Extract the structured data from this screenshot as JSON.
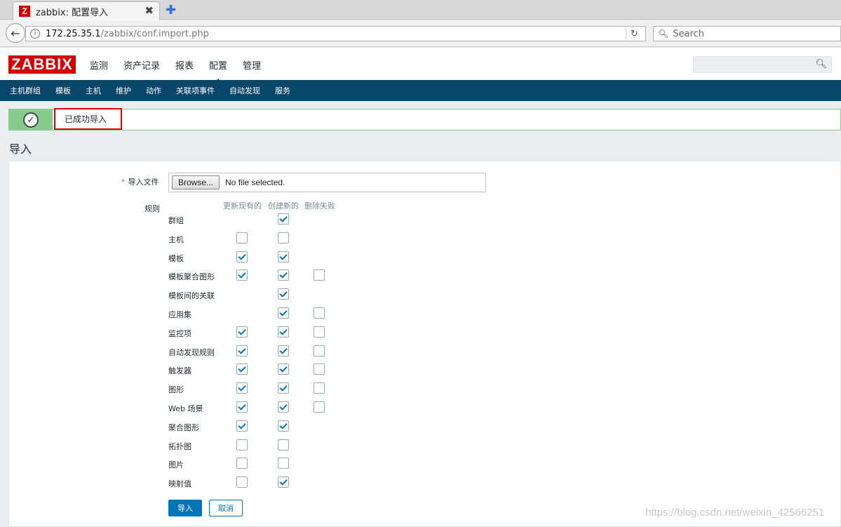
{
  "browser": {
    "tab_icon_letter": "Z",
    "tab_title": "zabbix: 配置导入",
    "tab_close": "✖",
    "new_tab": "✚",
    "url_host": "172.25.35.1",
    "url_path": "/zabbix/conf.import.php",
    "search_placeholder": "Search"
  },
  "header": {
    "logo": "ZABBIX",
    "menu": [
      {
        "label": "监测"
      },
      {
        "label": "资产记录"
      },
      {
        "label": "报表"
      },
      {
        "label": "配置",
        "active": true
      },
      {
        "label": "管理"
      }
    ]
  },
  "submenu": [
    {
      "label": "主机群组"
    },
    {
      "label": "模板"
    },
    {
      "label": "主机"
    },
    {
      "label": "维护"
    },
    {
      "label": "动作"
    },
    {
      "label": "关联项事件"
    },
    {
      "label": "自动发现"
    },
    {
      "label": "服务"
    }
  ],
  "message": {
    "text": "已成功导入"
  },
  "page": {
    "title": "导入"
  },
  "form": {
    "import_file_label": "导入文件",
    "required_mark": "*",
    "browse_label": "Browse...",
    "file_status": "No file selected.",
    "rules_label": "规则",
    "columns": {
      "update_existing": "更新现有的",
      "create_new": "创建新的",
      "delete_missing": "删除失败"
    },
    "rules": [
      {
        "name": "群组",
        "update": null,
        "create": true,
        "delete": null
      },
      {
        "name": "主机",
        "update": false,
        "create": false,
        "delete": null
      },
      {
        "name": "模板",
        "update": true,
        "create": true,
        "delete": null
      },
      {
        "name": "模板聚合图形",
        "update": true,
        "create": true,
        "delete": false
      },
      {
        "name": "模板间的关联",
        "update": null,
        "create": true,
        "delete": null
      },
      {
        "name": "应用集",
        "update": null,
        "create": true,
        "delete": false
      },
      {
        "name": "监控项",
        "update": true,
        "create": true,
        "delete": false
      },
      {
        "name": "自动发现规则",
        "update": true,
        "create": true,
        "delete": false
      },
      {
        "name": "触发器",
        "update": true,
        "create": true,
        "delete": false
      },
      {
        "name": "图形",
        "update": true,
        "create": true,
        "delete": false
      },
      {
        "name": "Web 场景",
        "update": true,
        "create": true,
        "delete": false
      },
      {
        "name": "聚合图形",
        "update": true,
        "create": true,
        "delete": null
      },
      {
        "name": "拓扑图",
        "update": false,
        "create": false,
        "delete": null
      },
      {
        "name": "图片",
        "update": false,
        "create": false,
        "delete": null
      },
      {
        "name": "映射值",
        "update": false,
        "create": true,
        "delete": null
      }
    ],
    "submit_label": "导入",
    "cancel_label": "取消"
  },
  "watermark": "https://blog.csdn.net/weixin_42566251"
}
